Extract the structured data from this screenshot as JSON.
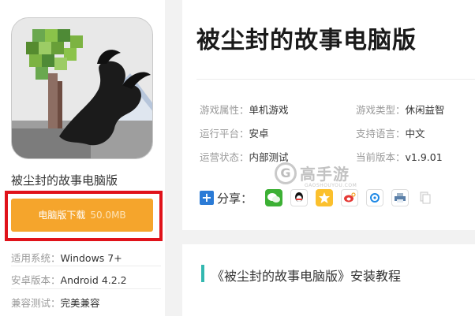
{
  "app": {
    "name": "被尘封的故事电脑版",
    "title": "被尘封的故事电脑版"
  },
  "download": {
    "label": "电脑版下载",
    "size": "50.0MB"
  },
  "specs": [
    {
      "key": "适用系统：",
      "value": "Windows 7+"
    },
    {
      "key": "安卓版本：",
      "value": "Android 4.2.2"
    },
    {
      "key": "兼容测试：",
      "value": "完美兼容"
    }
  ],
  "attributes": {
    "left": [
      {
        "key": "游戏属性：",
        "value": "单机游戏"
      },
      {
        "key": "运行平台：",
        "value": "安卓"
      },
      {
        "key": "运营状态：",
        "value": "内部测试"
      }
    ],
    "right": [
      {
        "key": "游戏类型：",
        "value": "休闲益智"
      },
      {
        "key": "支持语言：",
        "value": "中文"
      },
      {
        "key": "当前版本：",
        "value": "v1.9.01"
      }
    ]
  },
  "share": {
    "label": "分享：",
    "icons": [
      "wechat-icon",
      "qq-icon",
      "qzone-icon",
      "weibo-icon",
      "tencent-weibo-icon",
      "print-icon",
      "copy-icon"
    ]
  },
  "watermark": {
    "text": "高手游",
    "sub": "GAOSHOUYOU.COM"
  },
  "section": {
    "title": "《被尘封的故事电脑版》安装教程"
  },
  "colors": {
    "download_button": "#f5a52c",
    "highlight_box": "#e0121a",
    "section_accent": "#33b8b0",
    "share_plus": "#2b7bd6"
  }
}
